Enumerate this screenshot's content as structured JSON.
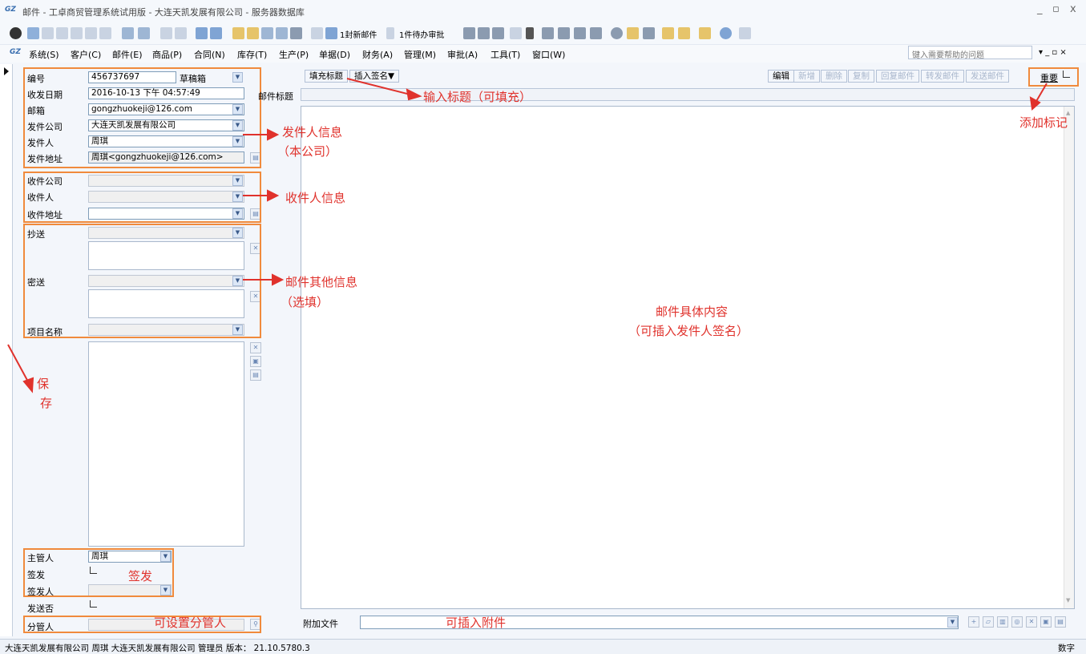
{
  "window": {
    "logo": "GZ",
    "title": "邮件 - 工卓商贸管理系统试用版 - 大连天凯发展有限公司 - 服务器数据库",
    "controls": [
      "_",
      "▫",
      "x"
    ]
  },
  "toolbar": {
    "new_mail_label": "1封新邮件",
    "pending_label": "1件待办审批"
  },
  "menu": {
    "logo": "GZ",
    "items": [
      "系统(S)",
      "客户(C)",
      "邮件(E)",
      "商品(P)",
      "合同(N)",
      "库存(T)",
      "生产(P)",
      "单据(D)",
      "财务(A)",
      "管理(M)",
      "审批(A)",
      "工具(T)",
      "窗口(W)"
    ],
    "help_placeholder": "键入需要帮助的问题",
    "mdi_controls": "▾ _ ▫ ×"
  },
  "form": {
    "number_label": "编号",
    "number_value": "456737697",
    "folder_value": "草稿箱",
    "date_label": "收发日期",
    "date_value": "2016-10-13 下午 04:57:49",
    "mailbox_label": "邮箱",
    "mailbox_value": "gongzhuokeji@126.com",
    "sender_company_label": "发件公司",
    "sender_company_value": "大连天凯发展有限公司",
    "sender_label": "发件人",
    "sender_value": "周琪",
    "sender_address_label": "发件地址",
    "sender_address_value": "周琪<gongzhuokeji@126.com>",
    "recv_company_label": "收件公司",
    "recv_label": "收件人",
    "recv_address_label": "收件地址",
    "cc_label": "抄送",
    "bcc_label": "密送",
    "project_label": "项目名称",
    "manager_label": "主管人",
    "manager_value": "周琪",
    "sign_label": "签发",
    "signer_label": "签发人",
    "sent_label": "发送否",
    "submanager_label": "分管人"
  },
  "editor": {
    "fill_title_btn": "填充标题",
    "insert_sign_btn": "插入签名▼",
    "subject_label": "邮件标题",
    "buttons": [
      "编辑",
      "新增",
      "删除",
      "复制",
      "回复邮件",
      "转发邮件",
      "发送邮件"
    ],
    "important_label": "重要",
    "attachment_label": "附加文件"
  },
  "annotations": {
    "input_title": "输入标题（可填充）",
    "add_mark": "添加标记",
    "sender_info": "发件人信息",
    "own_company": "（本公司）",
    "recv_info": "收件人信息",
    "other_info": "邮件其他信息",
    "optional": "（选填）",
    "body_content": "邮件具体内容",
    "body_note": "（可插入发件人签名）",
    "save_1": "保",
    "save_2": "存",
    "sign": "签发",
    "set_submanager": "可设置分管人",
    "insert_attach": "可插入附件"
  },
  "status": {
    "text": "大连天凯发展有限公司 周琪 大连天凯发展有限公司 管理员 版本： 21.10.5780.3",
    "mode": "数字"
  },
  "colors": {
    "annotation": "#e0322c",
    "highlight_box": "#f08a3c"
  }
}
